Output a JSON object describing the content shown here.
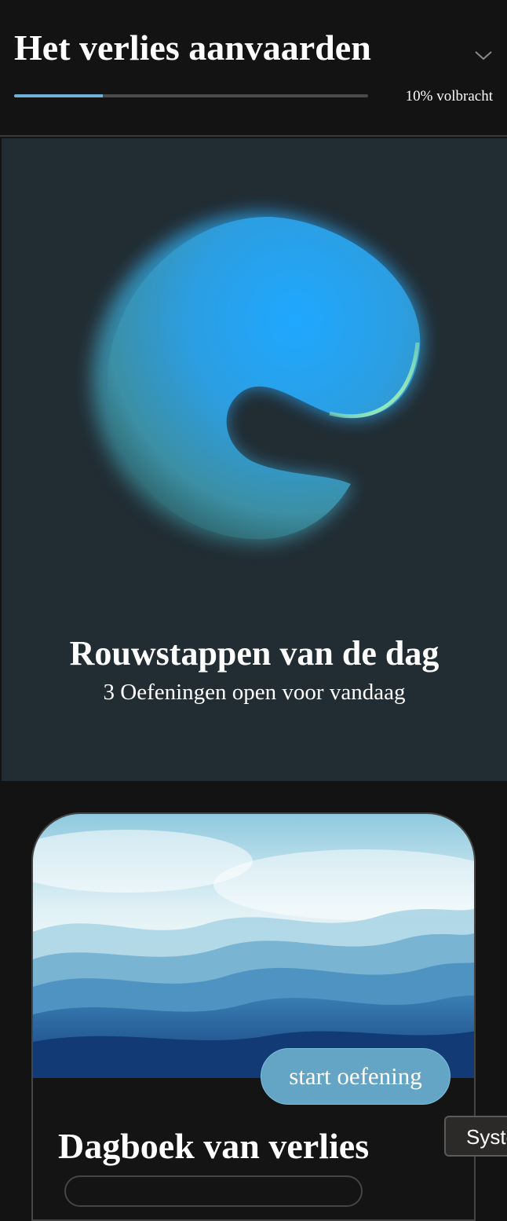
{
  "header": {
    "title": "Het verlies aanvaarden",
    "progress_percent": 10,
    "progress_label": "10% volbracht",
    "expand_icon": "chevron-down-icon",
    "accent_color": "#6fb1d6"
  },
  "hero": {
    "title": "Rouwstappen van de dag",
    "subtitle": "3 Oefeningen open voor vandaag",
    "illustration": "gradient-orb",
    "background_color": "#222c33"
  },
  "card": {
    "title": "Dagboek van verlies",
    "image": "watercolor-sea-waves",
    "start_button_label": "start oefening",
    "button_color": "#64a5c5"
  },
  "system_chip": {
    "label": "System"
  }
}
